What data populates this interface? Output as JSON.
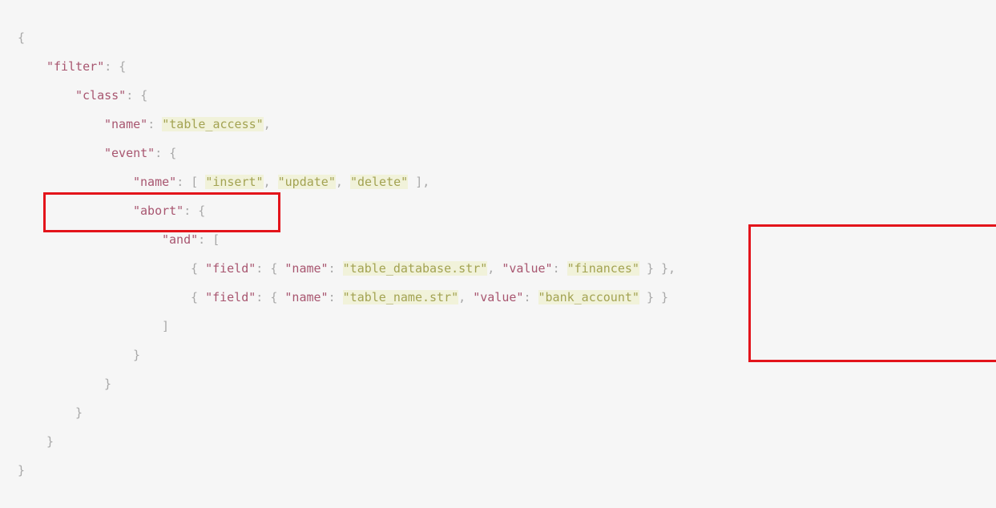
{
  "code": {
    "lines": [
      {
        "indent": 0,
        "tokens": [
          {
            "t": "p",
            "v": "{"
          }
        ]
      },
      {
        "indent": 1,
        "tokens": [
          {
            "t": "k",
            "v": "\"filter\""
          },
          {
            "t": "p",
            "v": ": {"
          }
        ]
      },
      {
        "indent": 2,
        "tokens": [
          {
            "t": "k",
            "v": "\"class\""
          },
          {
            "t": "p",
            "v": ": {"
          }
        ]
      },
      {
        "indent": 3,
        "tokens": [
          {
            "t": "k",
            "v": "\"name\""
          },
          {
            "t": "p",
            "v": ": "
          },
          {
            "t": "s",
            "v": "\"table_access\""
          },
          {
            "t": "p",
            "v": ","
          }
        ]
      },
      {
        "indent": 3,
        "tokens": [
          {
            "t": "k",
            "v": "\"event\""
          },
          {
            "t": "p",
            "v": ": {"
          }
        ]
      },
      {
        "indent": 4,
        "tokens": [
          {
            "t": "k",
            "v": "\"name\""
          },
          {
            "t": "p",
            "v": ": [ "
          },
          {
            "t": "s",
            "v": "\"insert\""
          },
          {
            "t": "p",
            "v": ", "
          },
          {
            "t": "s",
            "v": "\"update\""
          },
          {
            "t": "p",
            "v": ", "
          },
          {
            "t": "s",
            "v": "\"delete\""
          },
          {
            "t": "p",
            "v": " ],"
          }
        ]
      },
      {
        "indent": 4,
        "tokens": [
          {
            "t": "k",
            "v": "\"abort\""
          },
          {
            "t": "p",
            "v": ": {"
          }
        ]
      },
      {
        "indent": 5,
        "tokens": [
          {
            "t": "k",
            "v": "\"and\""
          },
          {
            "t": "p",
            "v": ": ["
          }
        ]
      },
      {
        "indent": 6,
        "tokens": [
          {
            "t": "p",
            "v": "{ "
          },
          {
            "t": "k",
            "v": "\"field\""
          },
          {
            "t": "p",
            "v": ": { "
          },
          {
            "t": "k",
            "v": "\"name\""
          },
          {
            "t": "p",
            "v": ": "
          },
          {
            "t": "s",
            "v": "\"table_database.str\""
          },
          {
            "t": "p",
            "v": ", "
          },
          {
            "t": "k",
            "v": "\"value\""
          },
          {
            "t": "p",
            "v": ": "
          },
          {
            "t": "s",
            "v": "\"finances\""
          },
          {
            "t": "p",
            "v": " } },"
          }
        ]
      },
      {
        "indent": 6,
        "tokens": [
          {
            "t": "p",
            "v": "{ "
          },
          {
            "t": "k",
            "v": "\"field\""
          },
          {
            "t": "p",
            "v": ": { "
          },
          {
            "t": "k",
            "v": "\"name\""
          },
          {
            "t": "p",
            "v": ": "
          },
          {
            "t": "s",
            "v": "\"table_name.str\""
          },
          {
            "t": "p",
            "v": ", "
          },
          {
            "t": "k",
            "v": "\"value\""
          },
          {
            "t": "p",
            "v": ": "
          },
          {
            "t": "s",
            "v": "\"bank_account\""
          },
          {
            "t": "p",
            "v": " } }"
          }
        ]
      },
      {
        "indent": 5,
        "tokens": [
          {
            "t": "p",
            "v": "]"
          }
        ]
      },
      {
        "indent": 4,
        "tokens": [
          {
            "t": "p",
            "v": "}"
          }
        ]
      },
      {
        "indent": 3,
        "tokens": [
          {
            "t": "p",
            "v": "}"
          }
        ]
      },
      {
        "indent": 2,
        "tokens": [
          {
            "t": "p",
            "v": "}"
          }
        ]
      },
      {
        "indent": 1,
        "tokens": [
          {
            "t": "p",
            "v": "}"
          }
        ]
      },
      {
        "indent": 0,
        "tokens": [
          {
            "t": "p",
            "v": "}"
          }
        ]
      }
    ]
  },
  "colors": {
    "background": "#f6f6f6",
    "key": "#a85670",
    "string": "#a3a352",
    "string_bg": "#f1f2da",
    "punctuation": "#a8a8a8",
    "highlight_border": "#e3141b"
  }
}
